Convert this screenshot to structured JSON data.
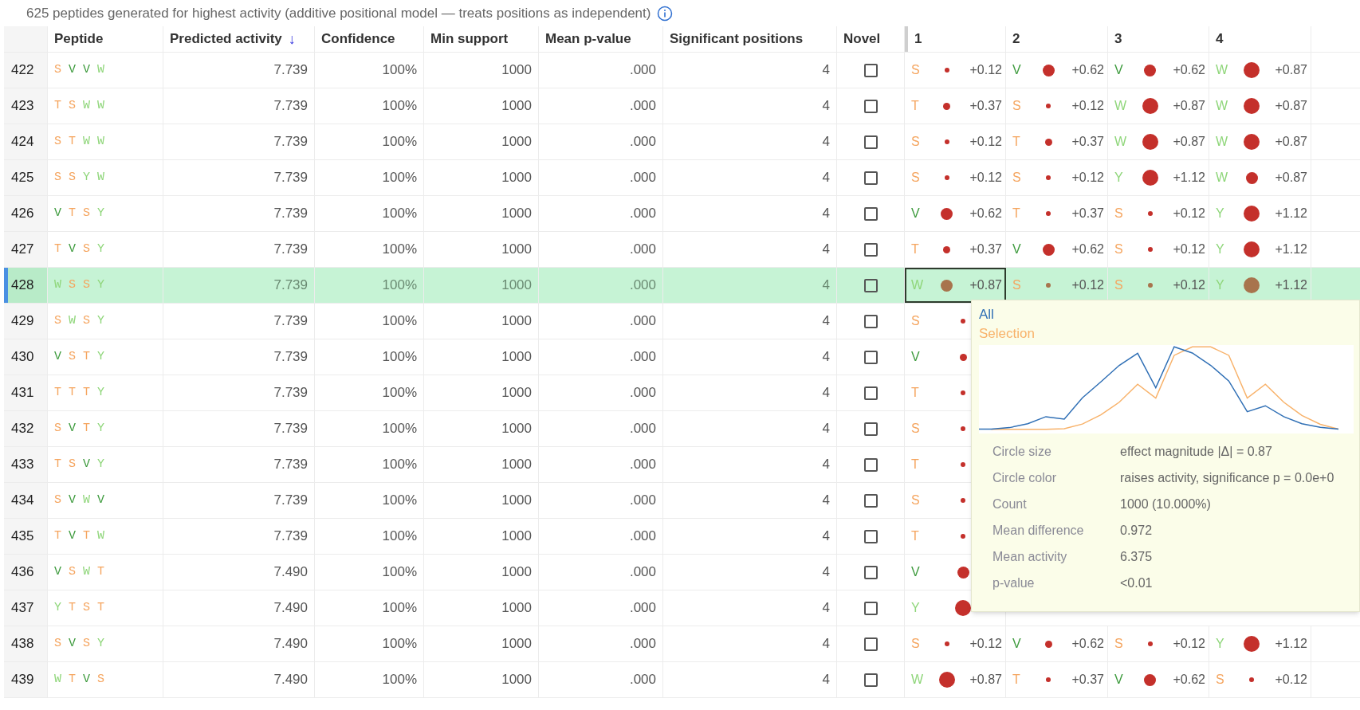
{
  "caption": "625 peptides generated for highest activity (additive positional model — treats positions as independent)",
  "columns": [
    {
      "label": "Peptide"
    },
    {
      "label": "Predicted activity",
      "sort_indicator": "↓"
    },
    {
      "label": "Confidence"
    },
    {
      "label": "Min support"
    },
    {
      "label": "Mean p-value"
    },
    {
      "label": "Significant positions"
    },
    {
      "label": "Novel"
    },
    {
      "label": "1"
    },
    {
      "label": "2"
    },
    {
      "label": "3"
    },
    {
      "label": "4"
    }
  ],
  "rows": [
    {
      "number": "422",
      "selected": false,
      "peptide": [
        {
          "letter": "S",
          "color": "#f5a55f"
        },
        {
          "letter": "V",
          "color": "#3e9b3e"
        },
        {
          "letter": "V",
          "color": "#3e9b3e"
        },
        {
          "letter": "W",
          "color": "#8fd67a"
        }
      ],
      "activity": "7.739",
      "confidence": "100%",
      "min_support": "1000",
      "mean_p": ".000",
      "significant": "4",
      "novel": false,
      "positions": [
        {
          "residue": "S",
          "color": "#f5a55f",
          "kind": "tiny",
          "effect": "+0.12",
          "focused": false
        },
        {
          "residue": "V",
          "color": "#3e9b3e",
          "kind": "medium",
          "effect": "+0.62",
          "focused": false
        },
        {
          "residue": "V",
          "color": "#3e9b3e",
          "kind": "medium",
          "effect": "+0.62",
          "focused": false
        },
        {
          "residue": "W",
          "color": "#8fd67a",
          "kind": "large",
          "effect": "+0.87",
          "focused": false
        }
      ]
    },
    {
      "number": "423",
      "selected": false,
      "peptide": [
        {
          "letter": "T",
          "color": "#f5a55f"
        },
        {
          "letter": "S",
          "color": "#f5a55f"
        },
        {
          "letter": "W",
          "color": "#8fd67a"
        },
        {
          "letter": "W",
          "color": "#8fd67a"
        }
      ],
      "activity": "7.739",
      "confidence": "100%",
      "min_support": "1000",
      "mean_p": ".000",
      "significant": "4",
      "novel": false,
      "positions": [
        {
          "residue": "T",
          "color": "#f5a55f",
          "kind": "small",
          "effect": "+0.37",
          "focused": false
        },
        {
          "residue": "S",
          "color": "#f5a55f",
          "kind": "tiny",
          "effect": "+0.12",
          "focused": false
        },
        {
          "residue": "W",
          "color": "#8fd67a",
          "kind": "large",
          "effect": "+0.87",
          "focused": false
        },
        {
          "residue": "W",
          "color": "#8fd67a",
          "kind": "large",
          "effect": "+0.87",
          "focused": false
        }
      ]
    },
    {
      "number": "424",
      "selected": false,
      "peptide": [
        {
          "letter": "S",
          "color": "#f5a55f"
        },
        {
          "letter": "T",
          "color": "#f5a55f"
        },
        {
          "letter": "W",
          "color": "#8fd67a"
        },
        {
          "letter": "W",
          "color": "#8fd67a"
        }
      ],
      "activity": "7.739",
      "confidence": "100%",
      "min_support": "1000",
      "mean_p": ".000",
      "significant": "4",
      "novel": false,
      "positions": [
        {
          "residue": "S",
          "color": "#f5a55f",
          "kind": "tiny",
          "effect": "+0.12",
          "focused": false
        },
        {
          "residue": "T",
          "color": "#f5a55f",
          "kind": "small",
          "effect": "+0.37",
          "focused": false
        },
        {
          "residue": "W",
          "color": "#8fd67a",
          "kind": "large",
          "effect": "+0.87",
          "focused": false
        },
        {
          "residue": "W",
          "color": "#8fd67a",
          "kind": "large",
          "effect": "+0.87",
          "focused": false
        }
      ]
    },
    {
      "number": "425",
      "selected": false,
      "peptide": [
        {
          "letter": "S",
          "color": "#f5a55f"
        },
        {
          "letter": "S",
          "color": "#f5a55f"
        },
        {
          "letter": "Y",
          "color": "#8fd67a"
        },
        {
          "letter": "W",
          "color": "#8fd67a"
        }
      ],
      "activity": "7.739",
      "confidence": "100%",
      "min_support": "1000",
      "mean_p": ".000",
      "significant": "4",
      "novel": false,
      "positions": [
        {
          "residue": "S",
          "color": "#f5a55f",
          "kind": "tiny",
          "effect": "+0.12",
          "focused": false
        },
        {
          "residue": "S",
          "color": "#f5a55f",
          "kind": "tiny",
          "effect": "+0.12",
          "focused": false
        },
        {
          "residue": "Y",
          "color": "#8fd67a",
          "kind": "large",
          "effect": "+1.12",
          "focused": false
        },
        {
          "residue": "W",
          "color": "#8fd67a",
          "kind": "medium",
          "effect": "+0.87",
          "focused": false
        }
      ]
    },
    {
      "number": "426",
      "selected": false,
      "peptide": [
        {
          "letter": "V",
          "color": "#3e9b3e"
        },
        {
          "letter": "T",
          "color": "#f5a55f"
        },
        {
          "letter": "S",
          "color": "#f5a55f"
        },
        {
          "letter": "Y",
          "color": "#8fd67a"
        }
      ],
      "activity": "7.739",
      "confidence": "100%",
      "min_support": "1000",
      "mean_p": ".000",
      "significant": "4",
      "novel": false,
      "positions": [
        {
          "residue": "V",
          "color": "#3e9b3e",
          "kind": "medium",
          "effect": "+0.62",
          "focused": false
        },
        {
          "residue": "T",
          "color": "#f5a55f",
          "kind": "tiny",
          "effect": "+0.37",
          "focused": false
        },
        {
          "residue": "S",
          "color": "#f5a55f",
          "kind": "tiny",
          "effect": "+0.12",
          "focused": false
        },
        {
          "residue": "Y",
          "color": "#8fd67a",
          "kind": "large",
          "effect": "+1.12",
          "focused": false
        }
      ]
    },
    {
      "number": "427",
      "selected": false,
      "peptide": [
        {
          "letter": "T",
          "color": "#f5a55f"
        },
        {
          "letter": "V",
          "color": "#3e9b3e"
        },
        {
          "letter": "S",
          "color": "#f5a55f"
        },
        {
          "letter": "Y",
          "color": "#8fd67a"
        }
      ],
      "activity": "7.739",
      "confidence": "100%",
      "min_support": "1000",
      "mean_p": ".000",
      "significant": "4",
      "novel": false,
      "positions": [
        {
          "residue": "T",
          "color": "#f5a55f",
          "kind": "small",
          "effect": "+0.37",
          "focused": false
        },
        {
          "residue": "V",
          "color": "#3e9b3e",
          "kind": "medium",
          "effect": "+0.62",
          "focused": false
        },
        {
          "residue": "S",
          "color": "#f5a55f",
          "kind": "tiny",
          "effect": "+0.12",
          "focused": false
        },
        {
          "residue": "Y",
          "color": "#8fd67a",
          "kind": "large",
          "effect": "+1.12",
          "focused": false
        }
      ]
    },
    {
      "number": "428",
      "selected": true,
      "peptide": [
        {
          "letter": "W",
          "color": "#8fd67a"
        },
        {
          "letter": "S",
          "color": "#f5a55f"
        },
        {
          "letter": "S",
          "color": "#f5a55f"
        },
        {
          "letter": "Y",
          "color": "#8fd67a"
        }
      ],
      "activity": "7.739",
      "confidence": "100%",
      "min_support": "1000",
      "mean_p": ".000",
      "significant": "4",
      "novel": false,
      "positions": [
        {
          "residue": "W",
          "color": "#8fd67a",
          "kind": "medium",
          "effect": "+0.87",
          "focused": true
        },
        {
          "residue": "S",
          "color": "#f5a55f",
          "kind": "tiny",
          "effect": "+0.12",
          "focused": false
        },
        {
          "residue": "S",
          "color": "#f5a55f",
          "kind": "tiny",
          "effect": "+0.12",
          "focused": false
        },
        {
          "residue": "Y",
          "color": "#8fd67a",
          "kind": "large",
          "effect": "+1.12",
          "focused": false
        }
      ]
    },
    {
      "number": "429",
      "selected": false,
      "peptide": [
        {
          "letter": "S",
          "color": "#f5a55f"
        },
        {
          "letter": "W",
          "color": "#8fd67a"
        },
        {
          "letter": "S",
          "color": "#f5a55f"
        },
        {
          "letter": "Y",
          "color": "#8fd67a"
        }
      ],
      "activity": "7.739",
      "confidence": "100%",
      "min_support": "1000",
      "mean_p": ".000",
      "significant": "4",
      "novel": false,
      "positions": [
        {
          "residue": "S",
          "color": "#f5a55f",
          "kind": "tiny",
          "focused": false
        }
      ]
    },
    {
      "number": "430",
      "selected": false,
      "peptide": [
        {
          "letter": "V",
          "color": "#3e9b3e"
        },
        {
          "letter": "S",
          "color": "#f5a55f"
        },
        {
          "letter": "T",
          "color": "#f5a55f"
        },
        {
          "letter": "Y",
          "color": "#8fd67a"
        }
      ],
      "activity": "7.739",
      "confidence": "100%",
      "min_support": "1000",
      "mean_p": ".000",
      "significant": "4",
      "novel": false,
      "positions": [
        {
          "residue": "V",
          "color": "#3e9b3e",
          "kind": "small",
          "focused": false
        }
      ]
    },
    {
      "number": "431",
      "selected": false,
      "peptide": [
        {
          "letter": "T",
          "color": "#f5a55f"
        },
        {
          "letter": "T",
          "color": "#f5a55f"
        },
        {
          "letter": "T",
          "color": "#f5a55f"
        },
        {
          "letter": "Y",
          "color": "#8fd67a"
        }
      ],
      "activity": "7.739",
      "confidence": "100%",
      "min_support": "1000",
      "mean_p": ".000",
      "significant": "4",
      "novel": false,
      "positions": [
        {
          "residue": "T",
          "color": "#f5a55f",
          "kind": "tiny",
          "focused": false
        }
      ]
    },
    {
      "number": "432",
      "selected": false,
      "peptide": [
        {
          "letter": "S",
          "color": "#f5a55f"
        },
        {
          "letter": "V",
          "color": "#3e9b3e"
        },
        {
          "letter": "T",
          "color": "#f5a55f"
        },
        {
          "letter": "Y",
          "color": "#8fd67a"
        }
      ],
      "activity": "7.739",
      "confidence": "100%",
      "min_support": "1000",
      "mean_p": ".000",
      "significant": "4",
      "novel": false,
      "positions": [
        {
          "residue": "S",
          "color": "#f5a55f",
          "kind": "tiny",
          "focused": false
        }
      ]
    },
    {
      "number": "433",
      "selected": false,
      "peptide": [
        {
          "letter": "T",
          "color": "#f5a55f"
        },
        {
          "letter": "S",
          "color": "#f5a55f"
        },
        {
          "letter": "V",
          "color": "#3e9b3e"
        },
        {
          "letter": "Y",
          "color": "#8fd67a"
        }
      ],
      "activity": "7.739",
      "confidence": "100%",
      "min_support": "1000",
      "mean_p": ".000",
      "significant": "4",
      "novel": false,
      "positions": [
        {
          "residue": "T",
          "color": "#f5a55f",
          "kind": "tiny",
          "focused": false
        }
      ]
    },
    {
      "number": "434",
      "selected": false,
      "peptide": [
        {
          "letter": "S",
          "color": "#f5a55f"
        },
        {
          "letter": "V",
          "color": "#3e9b3e"
        },
        {
          "letter": "W",
          "color": "#8fd67a"
        },
        {
          "letter": "V",
          "color": "#3e9b3e"
        }
      ],
      "activity": "7.739",
      "confidence": "100%",
      "min_support": "1000",
      "mean_p": ".000",
      "significant": "4",
      "novel": false,
      "positions": [
        {
          "residue": "S",
          "color": "#f5a55f",
          "kind": "tiny",
          "focused": false
        }
      ]
    },
    {
      "number": "435",
      "selected": false,
      "peptide": [
        {
          "letter": "T",
          "color": "#f5a55f"
        },
        {
          "letter": "V",
          "color": "#3e9b3e"
        },
        {
          "letter": "T",
          "color": "#f5a55f"
        },
        {
          "letter": "W",
          "color": "#8fd67a"
        }
      ],
      "activity": "7.739",
      "confidence": "100%",
      "min_support": "1000",
      "mean_p": ".000",
      "significant": "4",
      "novel": false,
      "positions": [
        {
          "residue": "T",
          "color": "#f5a55f",
          "kind": "tiny",
          "focused": false
        }
      ]
    },
    {
      "number": "436",
      "selected": false,
      "peptide": [
        {
          "letter": "V",
          "color": "#3e9b3e"
        },
        {
          "letter": "S",
          "color": "#f5a55f"
        },
        {
          "letter": "W",
          "color": "#8fd67a"
        },
        {
          "letter": "T",
          "color": "#f5a55f"
        }
      ],
      "activity": "7.490",
      "confidence": "100%",
      "min_support": "1000",
      "mean_p": ".000",
      "significant": "4",
      "novel": false,
      "positions": [
        {
          "residue": "V",
          "color": "#3e9b3e",
          "kind": "medium",
          "focused": false
        }
      ]
    },
    {
      "number": "437",
      "selected": false,
      "peptide": [
        {
          "letter": "Y",
          "color": "#8fd67a"
        },
        {
          "letter": "T",
          "color": "#f5a55f"
        },
        {
          "letter": "S",
          "color": "#f5a55f"
        },
        {
          "letter": "T",
          "color": "#f5a55f"
        }
      ],
      "activity": "7.490",
      "confidence": "100%",
      "min_support": "1000",
      "mean_p": ".000",
      "significant": "4",
      "novel": false,
      "positions": [
        {
          "residue": "Y",
          "color": "#8fd67a",
          "kind": "large",
          "focused": false
        }
      ]
    },
    {
      "number": "438",
      "selected": false,
      "peptide": [
        {
          "letter": "S",
          "color": "#f5a55f"
        },
        {
          "letter": "V",
          "color": "#3e9b3e"
        },
        {
          "letter": "S",
          "color": "#f5a55f"
        },
        {
          "letter": "Y",
          "color": "#8fd67a"
        }
      ],
      "activity": "7.490",
      "confidence": "100%",
      "min_support": "1000",
      "mean_p": ".000",
      "significant": "4",
      "novel": false,
      "positions": [
        {
          "residue": "S",
          "color": "#f5a55f",
          "kind": "tiny",
          "effect": "+0.12",
          "focused": false
        },
        {
          "residue": "V",
          "color": "#3e9b3e",
          "kind": "small",
          "effect": "+0.62",
          "focused": false
        },
        {
          "residue": "S",
          "color": "#f5a55f",
          "kind": "tiny",
          "effect": "+0.12",
          "focused": false
        },
        {
          "residue": "Y",
          "color": "#8fd67a",
          "kind": "large",
          "effect": "+1.12",
          "focused": false
        }
      ]
    },
    {
      "number": "439",
      "selected": false,
      "peptide": [
        {
          "letter": "W",
          "color": "#8fd67a"
        },
        {
          "letter": "T",
          "color": "#f5a55f"
        },
        {
          "letter": "V",
          "color": "#3e9b3e"
        },
        {
          "letter": "S",
          "color": "#f5a55f"
        }
      ],
      "activity": "7.490",
      "confidence": "100%",
      "min_support": "1000",
      "mean_p": ".000",
      "significant": "4",
      "novel": false,
      "positions": [
        {
          "residue": "W",
          "color": "#8fd67a",
          "kind": "large",
          "effect": "+0.87",
          "focused": false
        },
        {
          "residue": "T",
          "color": "#f5a55f",
          "kind": "tiny",
          "effect": "+0.37",
          "focused": false
        },
        {
          "residue": "V",
          "color": "#3e9b3e",
          "kind": "medium",
          "effect": "+0.62",
          "focused": false
        },
        {
          "residue": "S",
          "color": "#f5a55f",
          "kind": "tiny",
          "effect": "+0.12",
          "focused": false
        }
      ]
    }
  ],
  "tooltip": {
    "legend": [
      {
        "label": "All",
        "color": "#2f6fb5"
      },
      {
        "label": "Selection",
        "color": "#f8b26a"
      }
    ],
    "details": [
      {
        "label": "Circle size",
        "value": "effect magnitude |Δ| = 0.87"
      },
      {
        "label": "Circle color",
        "value": "raises activity, significance p = 0.0e+0"
      },
      {
        "label": "Count",
        "value": "1000 (10.000%)"
      },
      {
        "label": "Mean difference",
        "value": "0.972"
      },
      {
        "label": "Mean activity",
        "value": "6.375"
      },
      {
        "label": "p-value",
        "value": "<0.01"
      }
    ]
  }
}
